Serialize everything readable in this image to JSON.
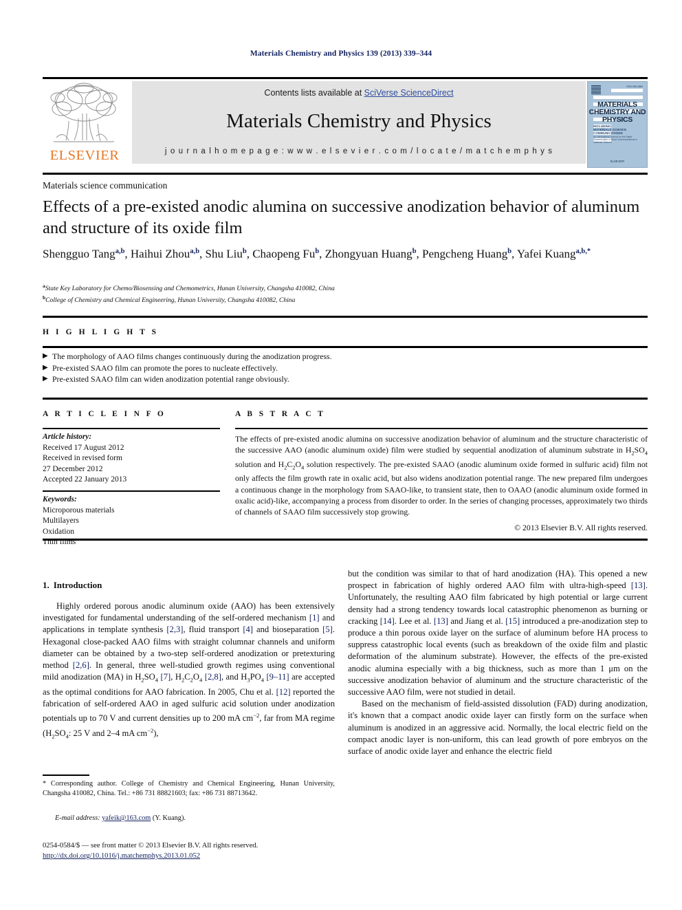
{
  "running_head": "Materials Chemistry and Physics 139 (2013) 339–344",
  "masthead": {
    "contents_prefix": "Contents lists available at ",
    "sciencedirect": "SciVerse ScienceDirect",
    "journal_name": "Materials Chemistry and Physics",
    "homepage": "j o u r n a l   h o m e p a g e :   w w w . e l s e v i e r . c o m / l o c a t e / m a t c h e m p h y s",
    "publisher_logo_text": "ELSEVIER",
    "publisher_accent_color": "#E87722",
    "cover": {
      "title_line1": "MATERIALS",
      "title_line2": "CHEMISTRY AND",
      "title_line3": "PHYSICS",
      "sub_line1": "INCLUDING",
      "sub_line2": "MATERIALS SCIENCE",
      "sub_line3": "COMMUNICATIONS",
      "blurb": "An International Journal for the Rapid Dissemination of Short Communications in Materials Science",
      "footer": "ELSEVIER"
    }
  },
  "section_label": "Materials science communication",
  "title": "Effects of a pre-existed anodic alumina on successive anodization behavior of aluminum and structure of its oxide film",
  "authors": [
    {
      "name": "Shengguo Tang",
      "sup": "a,b",
      "sep": ", "
    },
    {
      "name": "Haihui Zhou",
      "sup": "a,b",
      "sep": ", "
    },
    {
      "name": "Shu Liu",
      "sup": "b",
      "sep": ", "
    },
    {
      "name": "Chaopeng Fu",
      "sup": "b",
      "sep": ", "
    },
    {
      "name": "Zhongyuan Huang",
      "sup": "b",
      "sep": ", "
    },
    {
      "name": "Pengcheng Huang",
      "sup": "b",
      "sep": ", "
    },
    {
      "name": "Yafei Kuang",
      "sup": "a,b,*",
      "sep": ""
    }
  ],
  "affiliations": [
    {
      "marker": "a",
      "text": "State Key Laboratory for Chemo/Biosensing and Chemometrics, Hunan University, Changsha 410082, China"
    },
    {
      "marker": "b",
      "text": "College of Chemistry and Chemical Engineering, Hunan University, Changsha 410082, China"
    }
  ],
  "highlights": {
    "label": "H I G H L I G H T S",
    "bullet_glyph": "▶",
    "items": [
      "The morphology of AAO films changes continuously during the anodization progress.",
      "Pre-existed SAAO film can promote the pores to nucleate effectively.",
      "Pre-existed SAAO film can widen anodization potential range obviously."
    ]
  },
  "article_info": {
    "label": "A R T I C L E   I N F O",
    "history_label": "Article history:",
    "history": [
      "Received 17 August 2012",
      "Received in revised form",
      "27 December 2012",
      "Accepted 22 January 2013"
    ],
    "keywords_label": "Keywords:",
    "keywords": [
      "Microporous materials",
      "Multilayers",
      "Oxidation",
      "Thin films"
    ]
  },
  "abstract": {
    "label": "A B S T R A C T",
    "text_part1": "The effects of pre-existed anodic alumina on successive anodization behavior of aluminum and the structure characteristic of the successive AAO (anodic aluminum oxide) film were studied by sequential anodization of aluminum substrate in H",
    "f1_sub": "2",
    "f1_mid": "SO",
    "f1_sub2": "4",
    "text_part2": " solution and H",
    "f2_s1": "2",
    "f2_m1": "C",
    "f2_s2": "2",
    "f2_m2": "O",
    "f2_s3": "4",
    "text_part3": " solution respectively. The pre-existed SAAO (anodic aluminum oxide formed in sulfuric acid) film not only affects the film growth rate in oxalic acid, but also widens anodization potential range. The new prepared film undergoes a continuous change in the morphology from SAAO-like, to transient state, then to OAAO (anodic aluminum oxide formed in oxalic acid)-like, accompanying a process from disorder to order. In the series of changing processes, approximately two thirds of channels of SAAO film successively stop growing.",
    "copyright": "© 2013 Elsevier B.V. All rights reserved."
  },
  "body": {
    "intro_number": "1.",
    "intro_heading": "Introduction",
    "left_paragraph_1": {
      "p1": "Highly ordered porous anodic aluminum oxide (AAO) has been extensively investigated for fundamental understanding of the self-ordered mechanism ",
      "r1": "[1]",
      "p2": " and applications in template synthesis ",
      "r2": "[2,3]",
      "p3": ", fluid transport ",
      "r3": "[4]",
      "p4": " and bioseparation ",
      "r4": "[5]",
      "p5": ". Hexagonal close-packed AAO films with straight columnar channels and uniform diameter can be obtained by a two-step self-ordered anodization or pretexturing method ",
      "r5": "[2,6]",
      "p6": ". In general, three well-studied growth regimes using conventional mild anodization (MA) in H",
      "p7": "SO",
      "r6": "[7]",
      "p8": ", H",
      "p9": "C",
      "p10": "O",
      "r7": "[2,8]",
      "p11": ", and H",
      "p12": "PO",
      "r8": "[9–11]",
      "p13": " are accepted as the optimal conditions for AAO fabrication. In 2005, Chu et al. ",
      "r9": "[12]",
      "p14": " reported the fabrication of self-ordered AAO in aged sulfuric acid solution under anodization potentials up to 70 V and current densities up to 200 mA cm",
      "p15": ", far from MA regime (H",
      "p16": "SO",
      "p17": ": 25 V and 2–4 mA cm",
      "p18": "),"
    },
    "right_paragraph_1": {
      "p1": "but the condition was similar to that of hard anodization (HA). This opened a new prospect in fabrication of highly ordered AAO film with ultra-high-speed ",
      "r1": "[13]",
      "p2": ". Unfortunately, the resulting AAO film fabricated by high potential or large current density had a strong tendency towards local catastrophic phenomenon as burning or cracking ",
      "r2": "[14]",
      "p3": ". Lee et al. ",
      "r3": "[13]",
      "p4": " and Jiang et al. ",
      "r4": "[15]",
      "p5": " introduced a pre-anodization step to produce a thin porous oxide layer on the surface of aluminum before HA process to suppress catastrophic local events (such as breakdown of the oxide film and plastic deformation of the aluminum substrate). However, the effects of the pre-existed anodic alumina especially with a big thickness, such as more than 1 μm on the successive anodization behavior of aluminum and the structure characteristic of the successive AAO film, were not studied in detail."
    },
    "right_paragraph_2": "Based on the mechanism of field-assisted dissolution (FAD) during anodization, it's known that a compact anodic oxide layer can firstly form on the surface when aluminum is anodized in an aggressive acid. Normally, the local electric field on the compact anodic layer is non-uniform, this can lead growth of pore embryos on the surface of anodic oxide layer and enhance the electric field"
  },
  "footnotes": {
    "corresponding": "* Corresponding author. College of Chemistry and Chemical Engineering, Hunan University, Changsha 410082, China. Tel.: +86 731 88821603; fax: +86 731 88713642.",
    "email_label": "E-mail address:",
    "email_address": "yafeik@163.com",
    "email_suffix": "(Y. Kuang).",
    "imprint": "0254-0584/$ — see front matter © 2013 Elsevier B.V. All rights reserved.",
    "doi": "http://dx.doi.org/10.1016/j.matchemphys.2013.01.052"
  }
}
